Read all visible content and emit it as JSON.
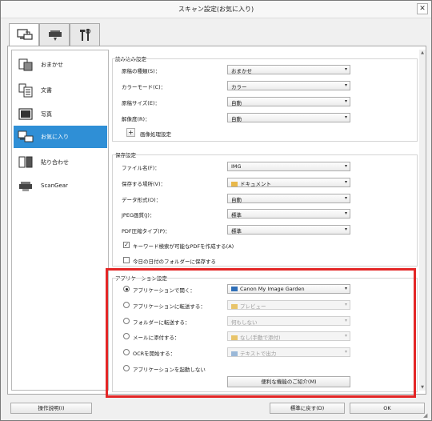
{
  "window": {
    "title": "スキャン設定(お気に入り)",
    "close_label": "✕"
  },
  "tabs": [
    {
      "name": "scan-from-computer-tab",
      "icon": "computer-scanner-icon",
      "active": true
    },
    {
      "name": "scan-from-operation-panel-tab",
      "icon": "scanner-icon",
      "active": false
    },
    {
      "name": "general-settings-tab",
      "icon": "tools-icon",
      "active": false
    }
  ],
  "sidebar": {
    "items": [
      {
        "label": "おまかせ",
        "icon": "auto-icon",
        "active": false
      },
      {
        "label": "文書",
        "icon": "document-icon",
        "active": false
      },
      {
        "label": "写真",
        "icon": "photo-icon",
        "active": false
      },
      {
        "label": "お気に入り",
        "icon": "favorite-icon",
        "active": true
      },
      {
        "label": "貼り合わせ",
        "icon": "stitch-icon",
        "active": false
      },
      {
        "label": "ScanGear",
        "icon": "scangear-icon",
        "active": false
      }
    ]
  },
  "scan_options": {
    "title": "読み込み設定",
    "rows": [
      {
        "label": "原稿の種類(S)：",
        "value": "おまかせ"
      },
      {
        "label": "カラーモード(C)：",
        "value": "カラー"
      },
      {
        "label": "原稿サイズ(E)：",
        "value": "自動"
      },
      {
        "label": "解像度(R)：",
        "value": "自動"
      }
    ],
    "image_processing_label": "画像処理設定",
    "plus_label": "+"
  },
  "save_settings": {
    "title": "保存設定",
    "rows": [
      {
        "label": "ファイル名(F)：",
        "value": "IMG",
        "kind": "text"
      },
      {
        "label": "保存する場所(V)：",
        "value": "ドキュメント",
        "kind": "folder"
      },
      {
        "label": "データ形式(O)：",
        "value": "自動",
        "kind": "select"
      },
      {
        "label": "JPEG画質(J)：",
        "value": "標準",
        "kind": "select"
      },
      {
        "label": "PDF圧縮タイプ(P)：",
        "value": "標準",
        "kind": "select"
      }
    ],
    "checkbox_keyword": {
      "label": "キーワード検索が可能なPDFを作成する(A)",
      "checked": true,
      "mark": "✓"
    },
    "checkbox_date_folder": {
      "label": "今日の日付のフォルダーに保存する",
      "checked": false,
      "mark": ""
    }
  },
  "app_settings": {
    "title": "アプリケーション設定",
    "options": [
      {
        "label": "アプリケーションで開く：",
        "value": "Canon My Image Garden",
        "selected": true,
        "enabled": true
      },
      {
        "label": "アプリケーションに転送する：",
        "value": "プレビュー",
        "selected": false,
        "enabled": false
      },
      {
        "label": "フォルダーに転送する：",
        "value": "何もしない",
        "selected": false,
        "enabled": false
      },
      {
        "label": "メールに添付する：",
        "value": "なし(手動で添付)",
        "selected": false,
        "enabled": false
      },
      {
        "label": "OCRを開始する：",
        "value": "テキストで出力",
        "selected": false,
        "enabled": false
      },
      {
        "label": "アプリケーションを起動しない",
        "value": "",
        "selected": false,
        "enabled": true
      }
    ],
    "more_functions_label": "便利な機能のご紹介(M)"
  },
  "bottom": {
    "instructions_label": "操作説明(I)",
    "defaults_label": "標準に戻す(D)",
    "ok_label": "OK"
  },
  "colors": {
    "accent": "#2f8fd6",
    "highlight": "#e32626"
  },
  "arrow_glyph": "▾",
  "resize_glyph": "◢"
}
